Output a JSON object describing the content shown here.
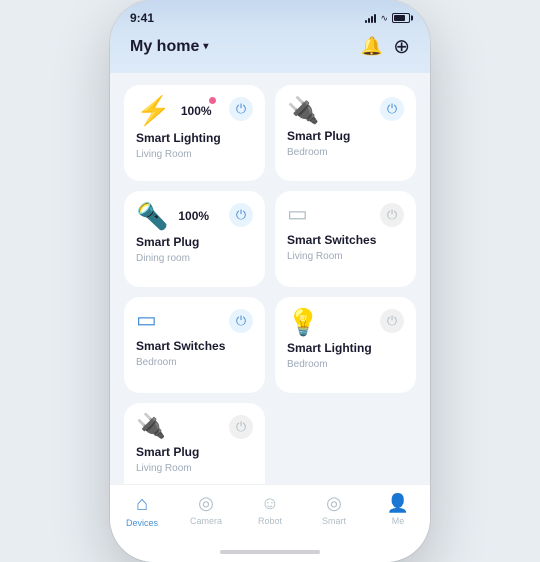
{
  "statusBar": {
    "time": "9:41"
  },
  "header": {
    "title": "My home",
    "chevron": "▾",
    "bellIcon": "🔔",
    "addIcon": "⊕"
  },
  "devices": [
    {
      "row": 0,
      "cards": [
        {
          "id": "smart-lighting-living",
          "name": "Smart Lighting",
          "location": "Living Room",
          "iconType": "lightning",
          "percentage": "100%",
          "hasPinkDot": true,
          "isOn": true
        },
        {
          "id": "smart-plug-bedroom",
          "name": "Smart Plug",
          "location": "Bedroom",
          "iconType": "plug",
          "percentage": null,
          "hasPinkDot": false,
          "isOn": true
        }
      ]
    },
    {
      "row": 1,
      "cards": [
        {
          "id": "smart-plug-dining",
          "name": "Smart Plug",
          "location": "Dining room",
          "iconType": "lamp",
          "percentage": "100%",
          "hasPinkDot": false,
          "isOn": true
        },
        {
          "id": "smart-switches-living",
          "name": "Smart Switches",
          "location": "Living Room",
          "iconType": "switch",
          "percentage": null,
          "hasPinkDot": false,
          "isOn": false
        }
      ]
    },
    {
      "row": 2,
      "cards": [
        {
          "id": "smart-switches-bedroom",
          "name": "Smart Switches",
          "location": "Bedroom",
          "iconType": "switch2",
          "percentage": null,
          "hasPinkDot": false,
          "isOn": true
        },
        {
          "id": "smart-lighting-bedroom",
          "name": "Smart Lighting",
          "location": "Bedroom",
          "iconType": "bulb",
          "percentage": null,
          "hasPinkDot": false,
          "isOn": false
        }
      ]
    },
    {
      "row": 3,
      "cards": [
        {
          "id": "smart-plug-living",
          "name": "Smart Plug",
          "location": "Living Room",
          "iconType": "plug2",
          "percentage": null,
          "hasPinkDot": false,
          "isOn": false
        }
      ]
    }
  ],
  "bottomNav": [
    {
      "id": "devices",
      "label": "Devices",
      "icon": "🏠",
      "active": true
    },
    {
      "id": "camera",
      "label": "Camera",
      "icon": "📷",
      "active": false
    },
    {
      "id": "robot",
      "label": "Robot",
      "icon": "😊",
      "active": false
    },
    {
      "id": "smart",
      "label": "Smart",
      "icon": "◎",
      "active": false
    },
    {
      "id": "me",
      "label": "Me",
      "icon": "👤",
      "active": false
    }
  ]
}
